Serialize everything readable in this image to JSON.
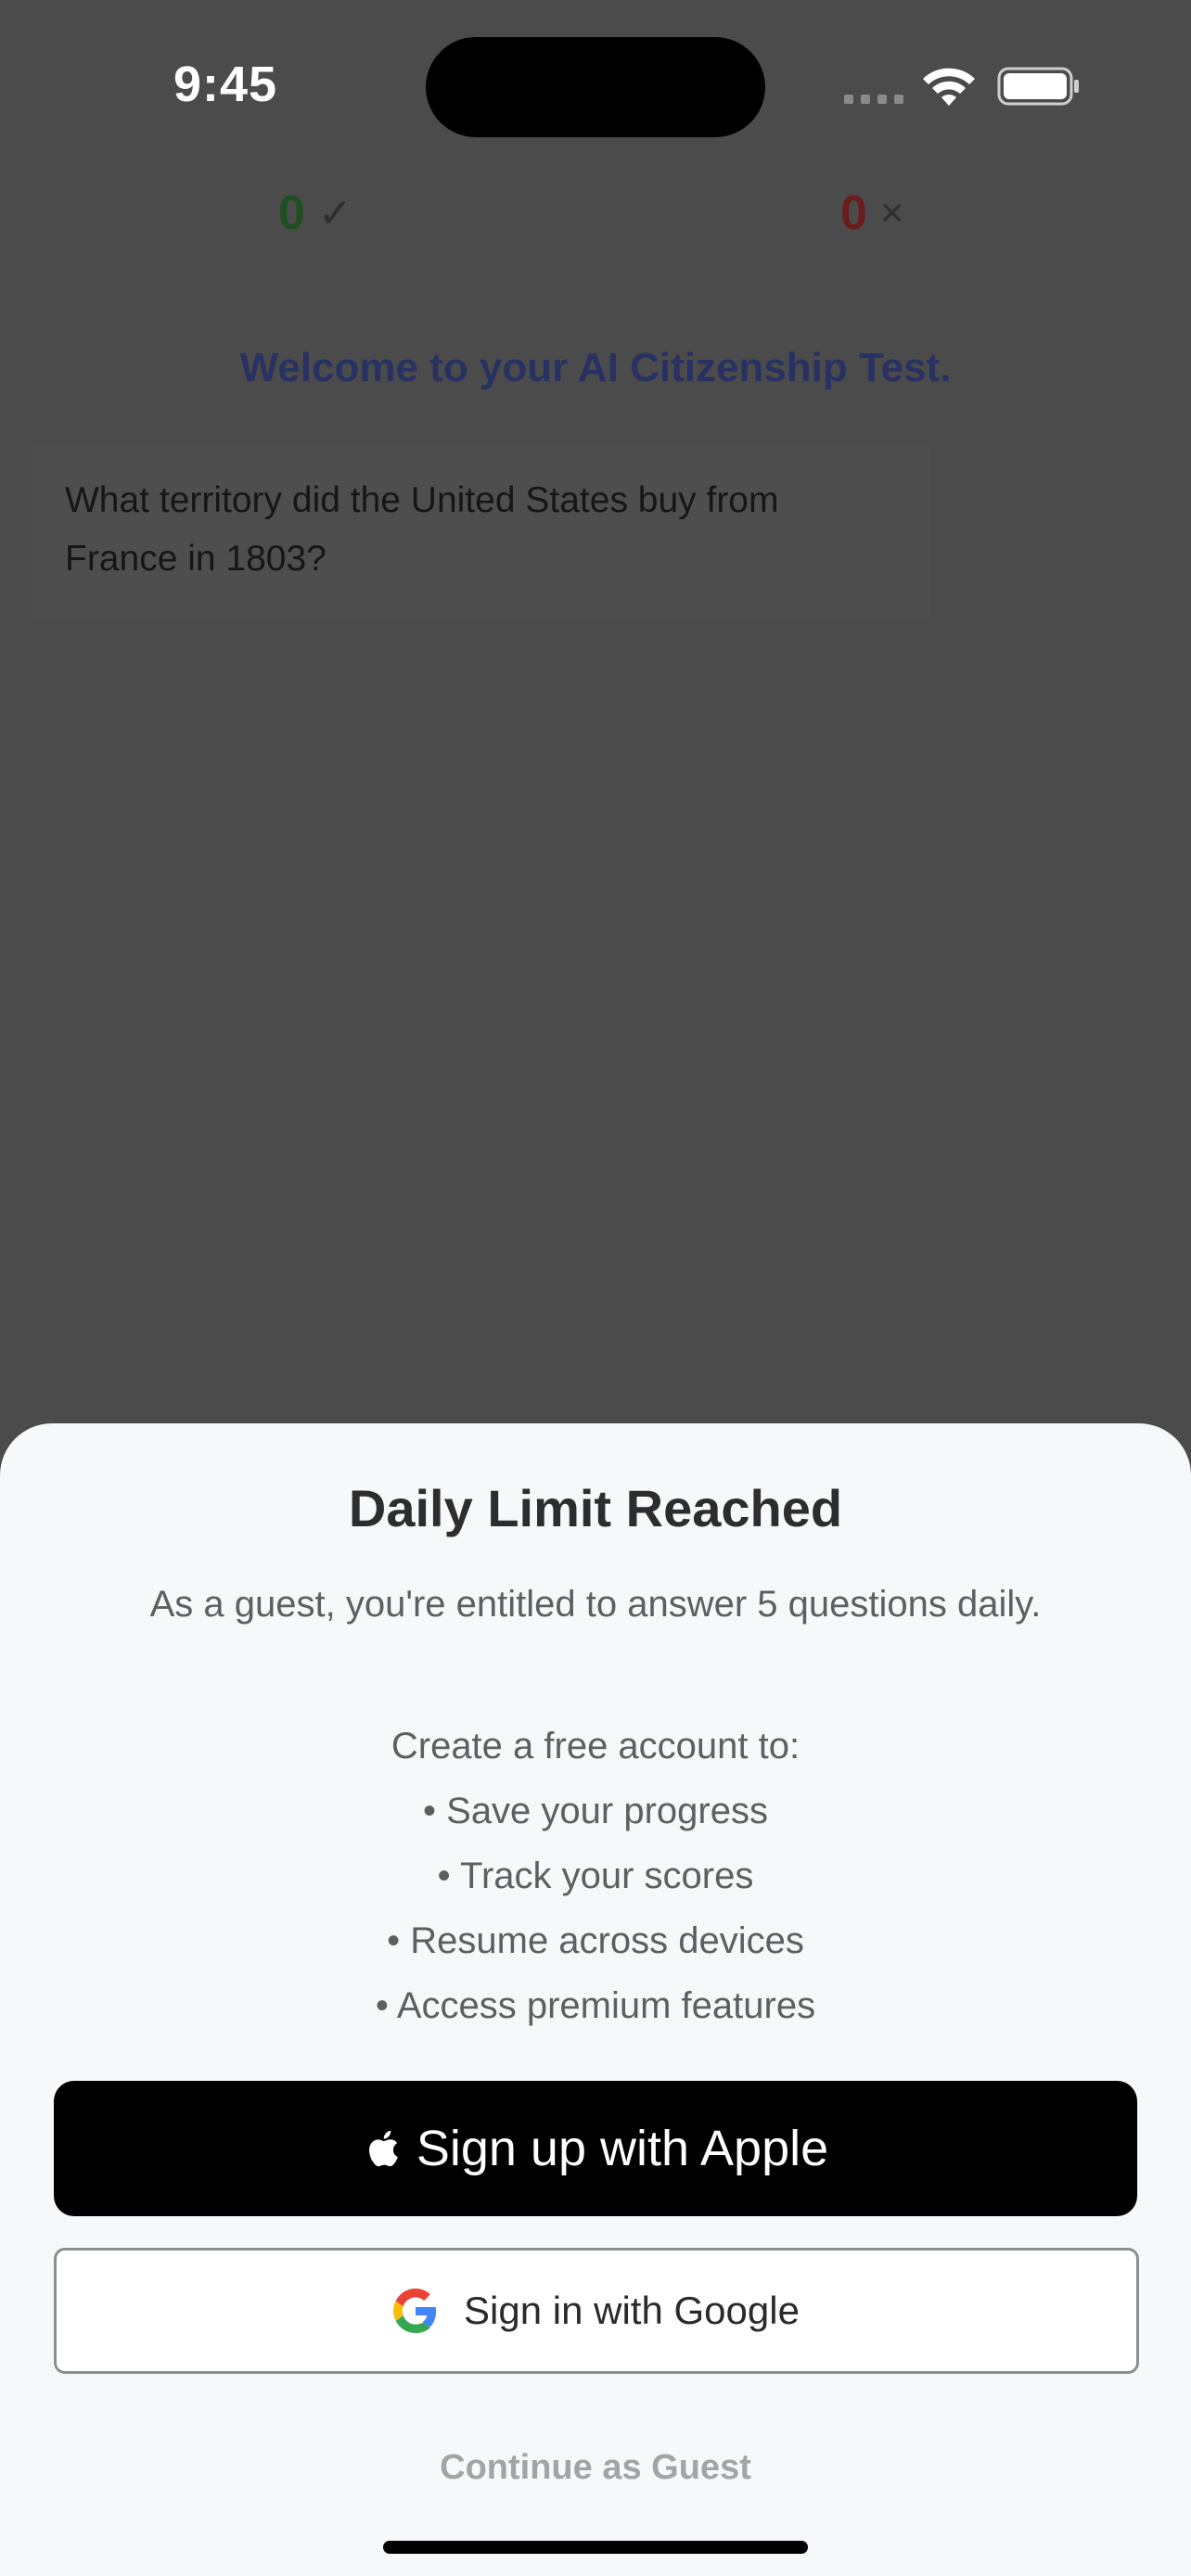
{
  "status_bar": {
    "time": "9:45"
  },
  "score": {
    "correct": "0",
    "correct_mark": "✓",
    "wrong": "0",
    "wrong_mark": "×"
  },
  "welcome": "Welcome to your AI Citizenship Test.",
  "question": {
    "line1": "What territory did the United States buy from",
    "line2": "France in 1803?"
  },
  "sheet": {
    "title": "Daily Limit Reached",
    "subtitle": "As a guest, you're entitled to answer 5 questions daily.",
    "benefits_intro": "Create a free account to:",
    "benefits": [
      "• Save your progress",
      "• Track your scores",
      "• Resume across devices",
      "• Access premium features"
    ],
    "apple_button": "Sign up with Apple",
    "google_button": "Sign in with Google",
    "guest_link": "Continue as Guest"
  },
  "icons": [
    "apple-icon",
    "google-icon",
    "wifi-icon",
    "battery-icon",
    "cellular-icon"
  ],
  "colors": {
    "overlay": "#4b4b4c",
    "sheet": "#f7f8fa",
    "correct": "#1f4f22",
    "wrong": "#6b1c1c",
    "welcome": "#283262"
  }
}
